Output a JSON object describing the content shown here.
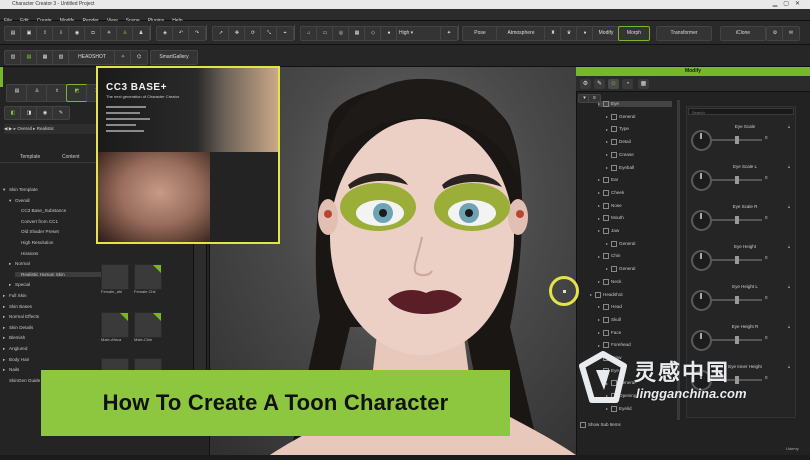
{
  "window": {
    "title": "Character Creator 3 - Untitled Project"
  },
  "menu": [
    "File",
    "Edit",
    "Create",
    "Modify",
    "Render",
    "View",
    "Scene",
    "Plugins",
    "Help"
  ],
  "toolbar": {
    "quality": "High",
    "pose": "Pose",
    "atmosphere": "Atmosphere",
    "modify": "Modify",
    "morph": "Morph",
    "transformer": "Transformer",
    "headshot": "HEADSHOT",
    "smart_gallery": "SmartGallery",
    "iclone": "iClone"
  },
  "left_panel": {
    "tabs": [
      "Template",
      "Content"
    ],
    "tree": [
      {
        "label": "Skin Template",
        "level": 0,
        "arrow": "▾"
      },
      {
        "label": "Overall",
        "level": 1,
        "arrow": "▾"
      },
      {
        "label": "CC3 Base_Substance",
        "level": 2,
        "arrow": ""
      },
      {
        "label": "Convert from CC1",
        "level": 2,
        "arrow": ""
      },
      {
        "label": "Old Shader Preset",
        "level": 2,
        "arrow": ""
      },
      {
        "label": "High Resolution",
        "level": 2,
        "arrow": ""
      },
      {
        "label": "Hissions",
        "level": 2,
        "arrow": ""
      },
      {
        "label": "Normal",
        "level": 1,
        "arrow": "▸"
      },
      {
        "label": "Realistic Human Skin",
        "level": 2,
        "arrow": "",
        "selected": true
      },
      {
        "label": "Special",
        "level": 1,
        "arrow": "▸"
      },
      {
        "label": "Full Skin",
        "level": 0,
        "arrow": "▸"
      },
      {
        "label": "Skin Bases",
        "level": 0,
        "arrow": "▸"
      },
      {
        "label": "Normal Effects",
        "level": 0,
        "arrow": "▸"
      },
      {
        "label": "Skin Details",
        "level": 0,
        "arrow": "▸"
      },
      {
        "label": "Blemish",
        "level": 0,
        "arrow": "▸"
      },
      {
        "label": "Anglured",
        "level": 0,
        "arrow": "▸"
      },
      {
        "label": "Body Hair",
        "level": 0,
        "arrow": "▸"
      },
      {
        "label": "Nails",
        "level": 0,
        "arrow": "▸"
      },
      {
        "label": "SkinGen Guide",
        "level": 0,
        "arrow": ""
      }
    ],
    "thumbnails": [
      "Female_afri",
      "Female Chil",
      "Male-Africa",
      "Male-Chin"
    ],
    "breadcrumb": "Overall",
    "breadcrumb_sub": "Realistic"
  },
  "preview": {
    "title": "CC3 BASE+",
    "subtitle": "The next generation of Character Creator"
  },
  "right_panel": {
    "header": "Modify",
    "search_placeholder": "Search",
    "tree": [
      {
        "label": "Eye",
        "selected": true
      },
      {
        "label": "General"
      },
      {
        "label": "Type"
      },
      {
        "label": "Detail"
      },
      {
        "label": "Crease"
      },
      {
        "label": "Eyeball"
      },
      {
        "label": "Ear"
      },
      {
        "label": "Cheek"
      },
      {
        "label": "Nose"
      },
      {
        "label": "Mouth"
      },
      {
        "label": "Jaw"
      },
      {
        "label": "General"
      },
      {
        "label": "Chin"
      },
      {
        "label": "General"
      },
      {
        "label": "Neck"
      },
      {
        "label": "Headshot"
      },
      {
        "label": "Head"
      },
      {
        "label": "Skull"
      },
      {
        "label": "Face"
      },
      {
        "label": "Forehead"
      },
      {
        "label": "Brow"
      },
      {
        "label": "Eye"
      },
      {
        "label": "General"
      },
      {
        "label": "Opening"
      },
      {
        "label": "Eyelid"
      }
    ],
    "sliders": [
      {
        "label": "Eye Scale",
        "value": "0",
        "level": 0.5
      },
      {
        "label": "Eye Scale L",
        "value": "0",
        "level": 0.5
      },
      {
        "label": "Eye Scale R",
        "value": "0",
        "level": 0.5
      },
      {
        "label": "Eye Height",
        "value": "0",
        "level": 0.5
      },
      {
        "label": "Eye Height L",
        "value": "0",
        "level": 0.5
      },
      {
        "label": "Eye Height R",
        "value": "0",
        "level": 0.5
      },
      {
        "label": "Eye Inner Height",
        "value": "0",
        "level": 0.5
      }
    ],
    "show_sub_items": "Show Sub Items",
    "footer": "Udemy"
  },
  "headline": "How To Create A Toon Character",
  "watermark": {
    "cn": "灵感中国",
    "url": "lingganchina.com"
  },
  "colors": {
    "accent": "#8dc63f",
    "highlight": "#e4e44a",
    "panel": "#242424"
  }
}
